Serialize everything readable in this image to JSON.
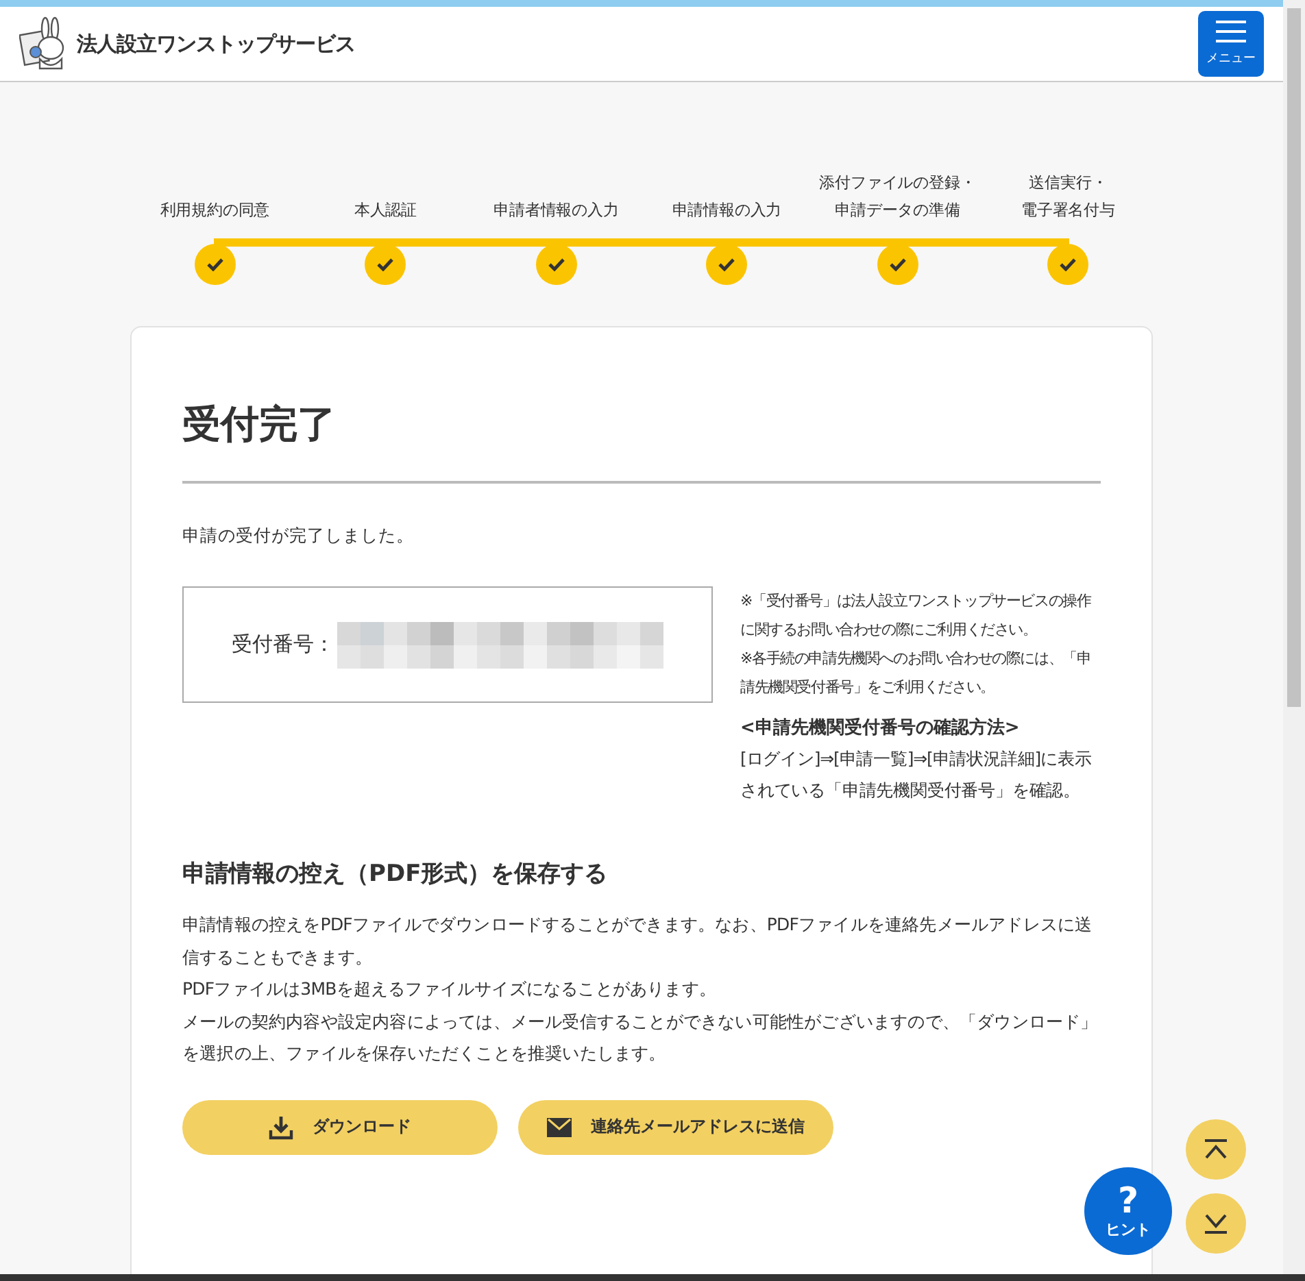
{
  "header": {
    "title": "法人設立ワンストップサービス",
    "menu_label": "メニュー"
  },
  "steps": [
    {
      "label": "利用規約の同意",
      "done": true
    },
    {
      "label": "本人認証",
      "done": true
    },
    {
      "label": "申請者情報の入力",
      "done": true
    },
    {
      "label": "申請情報の入力",
      "done": true
    },
    {
      "label": "添付ファイルの登録・",
      "label_2": "申請データの準備",
      "done": true
    },
    {
      "label": "送信実行・",
      "label_2": "電子署名付与",
      "done": true
    }
  ],
  "card": {
    "title": "受付完了",
    "message": "申請の受付が完了しました。",
    "receipt_label": "受付番号：",
    "notes": [
      "※「受付番号」は法人設立ワンストップサービスの操作に関するお問い合わせの際にご利用ください。",
      "※各手続の申請先機関へのお問い合わせの際には、「申請先機関受付番号」をご利用ください。"
    ],
    "howto_title": "<申請先機関受付番号の確認方法>",
    "howto_text": "[ログイン]⇒[申請一覧]⇒[申請状況詳細]に表示されている「申請先機関受付番号」を確認。",
    "pdf_heading": "申請情報の控え（PDF形式）を保存する",
    "pdf_text": [
      "申請情報の控えをPDFファイルでダウンロードすることができます。なお、PDFファイルを連絡先メールアドレスに送信することもできます。",
      "PDFファイルは3MBを超えるファイルサイズになることがあります。",
      "メールの契約内容や設定内容によっては、メール受信することができない可能性がございますので、「ダウンロード」を選択の上、ファイルを保存いただくことを推奨いたします。"
    ],
    "buttons": [
      {
        "kind": "download",
        "label": "ダウンロード"
      },
      {
        "kind": "mail",
        "label": "連絡先メールアドレスに送信"
      }
    ]
  },
  "hint": {
    "icon": "?",
    "label": "ヒント"
  }
}
